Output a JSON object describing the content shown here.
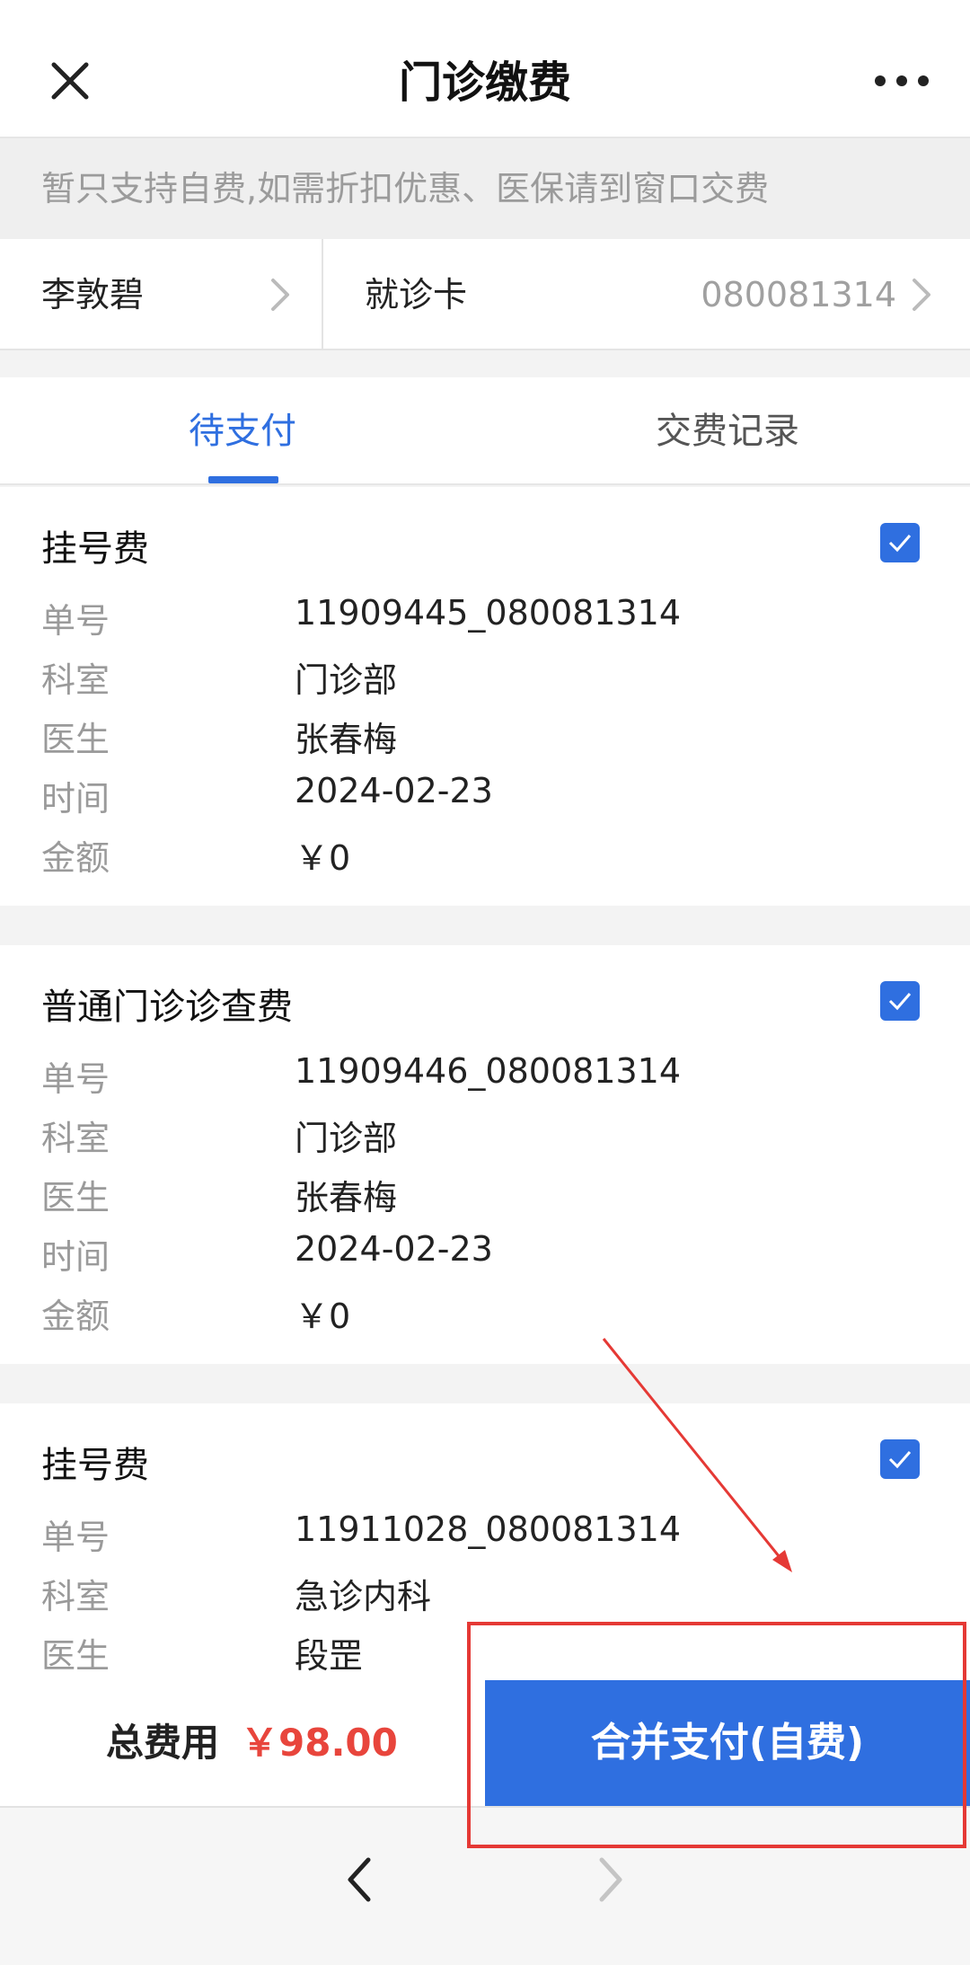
{
  "header": {
    "title": "门诊缴费",
    "close_icon": "close-icon",
    "more_icon": "more-icon"
  },
  "notice": "暂只支持自费,如需折扣优惠、医保请到窗口交费",
  "patient": {
    "name": "李敦碧",
    "card_label": "就诊卡",
    "card_number": "080081314"
  },
  "tabs": [
    {
      "label": "待支付",
      "active": true
    },
    {
      "label": "交费记录",
      "active": false
    }
  ],
  "field_labels": {
    "order": "单号",
    "dept": "科室",
    "doctor": "医生",
    "time": "时间",
    "amount": "金额"
  },
  "bills": [
    {
      "title": "挂号费",
      "order": "11909445_080081314",
      "dept": "门诊部",
      "doctor": "张春梅",
      "time": "2024-02-23",
      "amount": "￥0",
      "checked": true
    },
    {
      "title": "普通门诊诊查费",
      "order": "11909446_080081314",
      "dept": "门诊部",
      "doctor": "张春梅",
      "time": "2024-02-23",
      "amount": "￥0",
      "checked": true
    },
    {
      "title": "挂号费",
      "order": "11911028_080081314",
      "dept": "急诊内科",
      "doctor": "段罡",
      "checked": true
    }
  ],
  "footer": {
    "total_label": "总费用",
    "total_value": "￥98.00",
    "pay_button": "合并支付(自费)"
  },
  "colors": {
    "accent": "#2f6fe0",
    "price": "#e8453c",
    "annotation": "#e53935"
  }
}
